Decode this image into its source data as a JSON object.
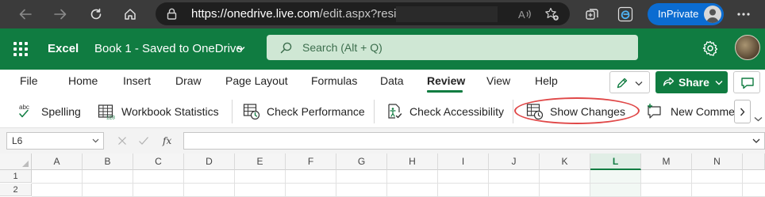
{
  "browser": {
    "url_host": "https://onedrive.live.com",
    "url_path": "/edit.aspx?resid=",
    "inprivate_label": "InPrivate",
    "icons": [
      "back-icon",
      "forward-icon",
      "refresh-icon",
      "home-icon",
      "lock-icon",
      "read-aloud-icon",
      "favorites-icon",
      "collections-icon",
      "edge-icon",
      "more-icon"
    ]
  },
  "excel": {
    "app_name": "Excel",
    "doc_title": "Book 1  -  Saved to OneDrive",
    "search_placeholder": "Search (Alt + Q)",
    "brand_color": "#107c41"
  },
  "ribbon": {
    "tabs": [
      {
        "label": "File",
        "active": false
      },
      {
        "label": "Home",
        "active": false
      },
      {
        "label": "Insert",
        "active": false
      },
      {
        "label": "Draw",
        "active": false
      },
      {
        "label": "Page Layout",
        "active": false
      },
      {
        "label": "Formulas",
        "active": false
      },
      {
        "label": "Data",
        "active": false
      },
      {
        "label": "Review",
        "active": true
      },
      {
        "label": "View",
        "active": false
      },
      {
        "label": "Help",
        "active": false
      }
    ],
    "share_label": "Share",
    "commands": [
      {
        "label": "Spelling",
        "icon": "spelling-icon"
      },
      {
        "label": "Workbook Statistics",
        "icon": "workbook-statistics-icon"
      },
      {
        "label": "Check Performance",
        "icon": "check-performance-icon"
      },
      {
        "label": "Check Accessibility",
        "icon": "check-accessibility-icon"
      },
      {
        "label": "Show Changes",
        "icon": "show-changes-icon",
        "highlighted": true
      },
      {
        "label": "New Comme",
        "icon": "new-comment-icon"
      }
    ],
    "highlight_color": "#e04848"
  },
  "formula_bar": {
    "name_box": "L6",
    "formula": ""
  },
  "grid": {
    "columns": [
      "A",
      "B",
      "C",
      "D",
      "E",
      "F",
      "G",
      "H",
      "I",
      "J",
      "K",
      "L",
      "M",
      "N"
    ],
    "selected_column": "L",
    "rows": [
      "1",
      "2"
    ]
  }
}
